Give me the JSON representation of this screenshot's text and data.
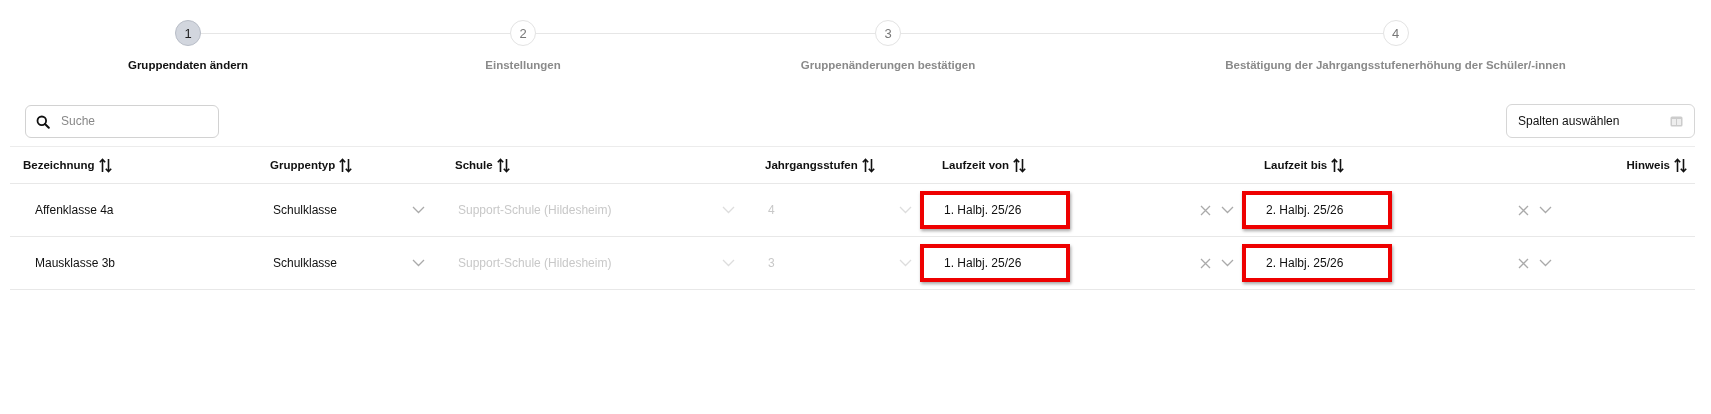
{
  "stepper": [
    {
      "number": "1",
      "label": "Gruppendaten ändern",
      "selected": true
    },
    {
      "number": "2",
      "label": "Einstellungen",
      "selected": false
    },
    {
      "number": "3",
      "label": "Gruppenänderungen bestätigen",
      "selected": false
    },
    {
      "number": "4",
      "label": "Bestätigung der Jahrgangsstufenerhöhung der Schüler/-innen",
      "selected": false
    }
  ],
  "search": {
    "placeholder": "Suche"
  },
  "columns_button": {
    "label": "Spalten auswählen"
  },
  "table": {
    "columns": [
      "Bezeichnung",
      "Gruppentyp",
      "Schule",
      "Jahrgangsstufen",
      "Laufzeit von",
      "Laufzeit bis",
      "Hinweis"
    ],
    "rows": [
      {
        "name": "Affenklasse 4a",
        "selects": [
          {
            "value": "Schulklasse",
            "disabled": false,
            "clearable": false,
            "highlighted": false
          },
          {
            "value": "Support-Schule (Hildesheim)",
            "disabled": true,
            "clearable": false,
            "highlighted": false
          },
          {
            "value": "4",
            "disabled": true,
            "clearable": false,
            "highlighted": false
          },
          {
            "value": "1. Halbj. 25/26",
            "disabled": false,
            "clearable": true,
            "highlighted": true
          },
          {
            "value": "2. Halbj. 25/26",
            "disabled": false,
            "clearable": true,
            "highlighted": true
          }
        ]
      },
      {
        "name": "Mausklasse 3b",
        "selects": [
          {
            "value": "Schulklasse",
            "disabled": false,
            "clearable": false,
            "highlighted": false
          },
          {
            "value": "Support-Schule (Hildesheim)",
            "disabled": true,
            "clearable": false,
            "highlighted": false
          },
          {
            "value": "3",
            "disabled": true,
            "clearable": false,
            "highlighted": false
          },
          {
            "value": "1. Halbj. 25/26",
            "disabled": false,
            "clearable": true,
            "highlighted": true
          },
          {
            "value": "2. Halbj. 25/26",
            "disabled": false,
            "clearable": true,
            "highlighted": true
          }
        ]
      }
    ]
  }
}
